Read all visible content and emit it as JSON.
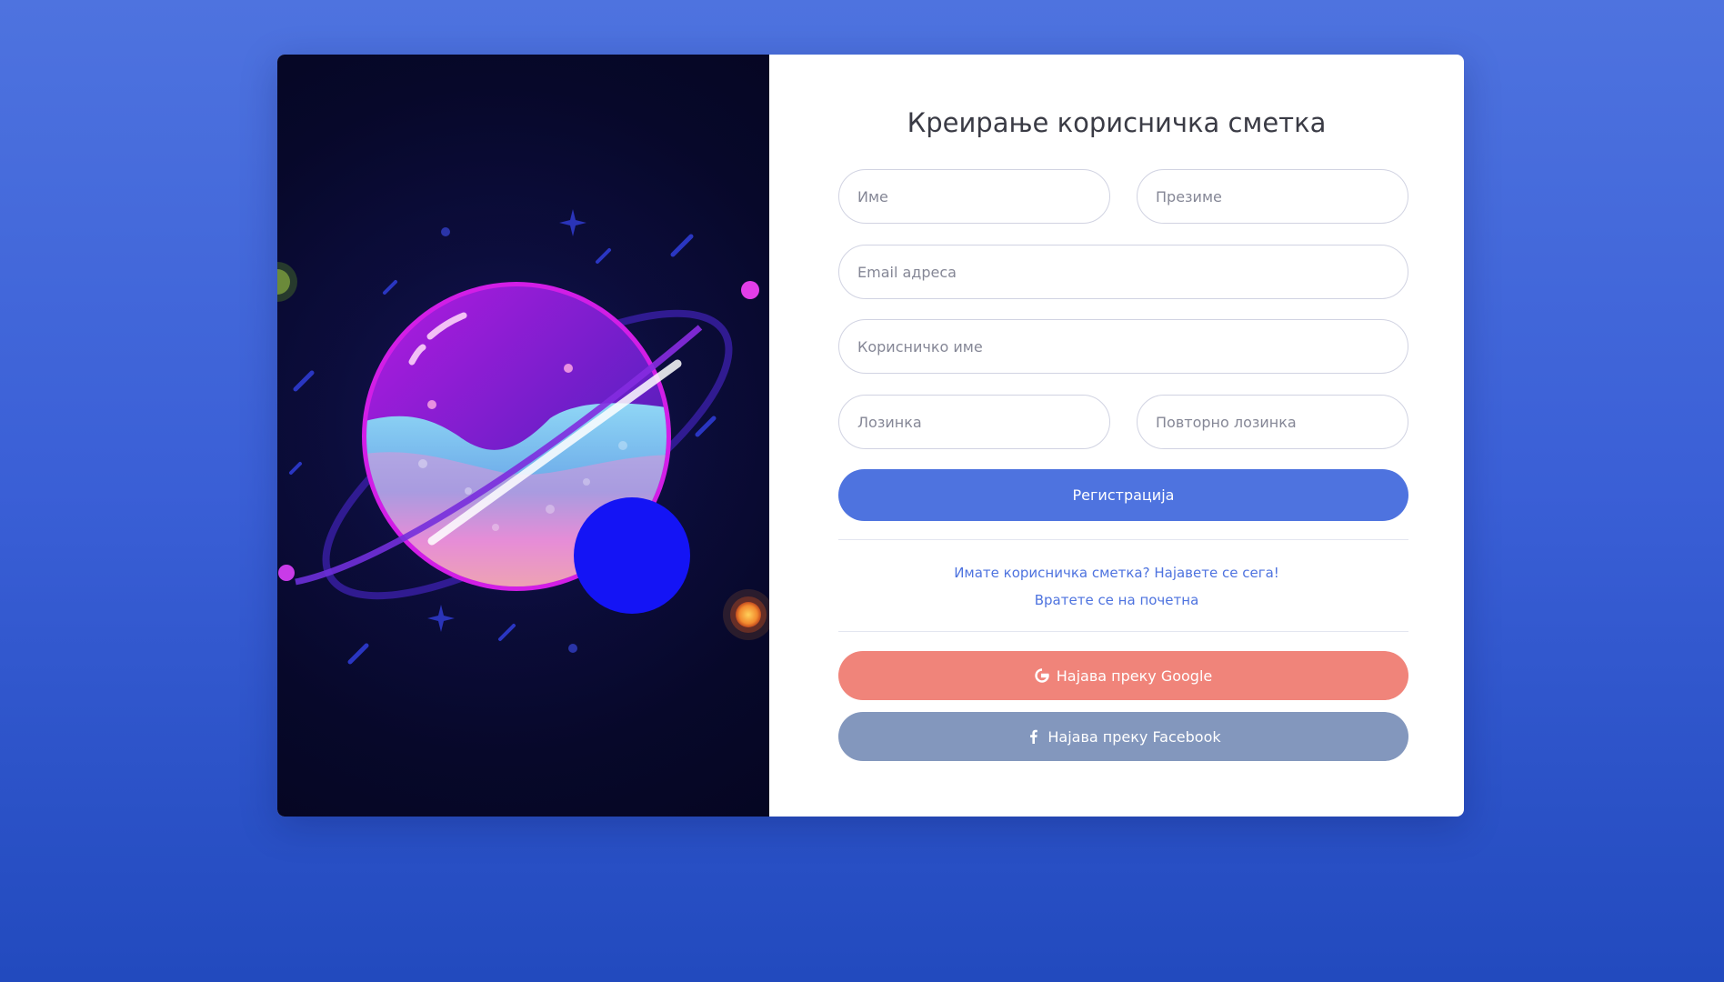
{
  "form": {
    "title": "Креирање корисничка сметка",
    "first_name_placeholder": "Име",
    "last_name_placeholder": "Презиме",
    "email_placeholder": "Email адреса",
    "username_placeholder": "Корисничко име",
    "password_placeholder": "Лозинка",
    "repeat_password_placeholder": "Повторно лозинка",
    "register_label": "Регистрација",
    "login_link": "Имате корисничка сметка? Најавете се сега!",
    "home_link": "Вратете се на почетна",
    "google_label": "Најава преку Google",
    "facebook_label": "Најава преку Facebook"
  },
  "icons": {
    "google": "google-icon",
    "facebook": "facebook-icon"
  },
  "colors": {
    "primary": "#4e73df",
    "google": "#f0847a",
    "facebook": "#8397bd",
    "background_top": "#4e73df",
    "background_bottom": "#224abe"
  }
}
